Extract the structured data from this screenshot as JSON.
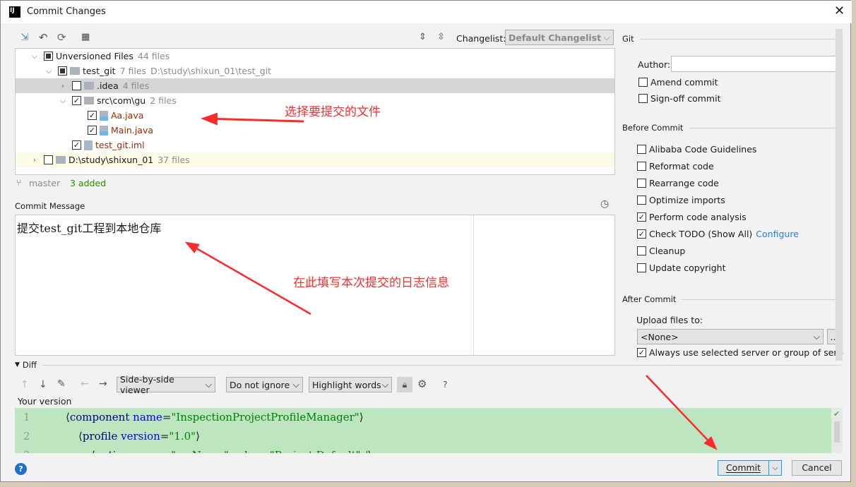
{
  "window": {
    "title": "Commit Changes"
  },
  "toolbar": {
    "changelist_label": "Changelist:",
    "changelist_value": "Default Changelist"
  },
  "tree": [
    {
      "label": "Unversioned Files",
      "meta": "44 files",
      "path": "",
      "level": 0,
      "expanded": true,
      "check": "partial",
      "kind": "root"
    },
    {
      "label": "test_git",
      "meta": "7 files",
      "path": "D:\\study\\shixun_01\\test_git",
      "level": 1,
      "expanded": true,
      "check": "partial",
      "kind": "module"
    },
    {
      "label": ".idea",
      "meta": "4 files",
      "path": "",
      "level": 2,
      "expanded": false,
      "check": "none",
      "kind": "folder",
      "selected": true
    },
    {
      "label": "src\\com\\gu",
      "meta": "2 files",
      "path": "",
      "level": 2,
      "expanded": true,
      "check": "checked",
      "kind": "folder"
    },
    {
      "label": "Aa.java",
      "meta": "",
      "path": "",
      "level": 3,
      "check": "checked",
      "kind": "java"
    },
    {
      "label": "Main.java",
      "meta": "",
      "path": "",
      "level": 3,
      "check": "checked",
      "kind": "java"
    },
    {
      "label": "test_git.iml",
      "meta": "",
      "path": "",
      "level": 2,
      "check": "checked",
      "kind": "iml"
    },
    {
      "label": "D:\\study\\shixun_01",
      "meta": "37 files",
      "path": "",
      "level": 0,
      "expanded": false,
      "check": "none",
      "kind": "folder",
      "highlight": true
    }
  ],
  "status": {
    "branch": "master",
    "added": "3 added"
  },
  "commit_message": {
    "label": "Commit Message",
    "value": "提交test_git工程到本地仓库"
  },
  "diff": {
    "label": "Diff",
    "viewer": "Side-by-side viewer",
    "ignore": "Do not ignore",
    "highlight": "Highlight words",
    "help": "?",
    "your_version": "Your version",
    "lines": [
      {
        "n": "1",
        "tag": "component",
        "attr": "name",
        "val": "\"InspectionProjectProfileManager\"",
        "indent": 0
      },
      {
        "n": "2",
        "tag": "profile",
        "attr": "version",
        "val": "\"1.0\"",
        "indent": 1
      },
      {
        "n": "3",
        "tag": "option",
        "attr": "name",
        "val": "\"myName\" value=\"Project Default\" /",
        "indent": 2
      }
    ]
  },
  "git": {
    "section": "Git",
    "author_label": "Author:",
    "author_value": "",
    "amend": "Amend commit",
    "signoff": "Sign-off commit"
  },
  "before_commit": {
    "section": "Before Commit",
    "options": [
      {
        "label": "Alibaba Code Guidelines",
        "checked": false
      },
      {
        "label": "Reformat code",
        "checked": false
      },
      {
        "label": "Rearrange code",
        "checked": false
      },
      {
        "label": "Optimize imports",
        "checked": false
      },
      {
        "label": "Perform code analysis",
        "checked": true
      },
      {
        "label": "Check TODO (Show All)",
        "checked": true,
        "link": "Configure"
      },
      {
        "label": "Cleanup",
        "checked": false
      },
      {
        "label": "Update copyright",
        "checked": false
      }
    ]
  },
  "after_commit": {
    "section": "After Commit",
    "upload_label": "Upload files to:",
    "upload_value": "<None>",
    "browse": "...",
    "always": "Always use selected server or group of servers"
  },
  "buttons": {
    "commit": "Commit",
    "cancel": "Cancel"
  },
  "annotations": {
    "select_files": "选择要提交的文件",
    "fill_message": "在此填写本次提交的日志信息"
  },
  "colors": {
    "accent": "#3d8fd6",
    "added_green": "#2a8a00",
    "diff_bg": "#bde5c0",
    "annotation": "#ff2a2a"
  }
}
